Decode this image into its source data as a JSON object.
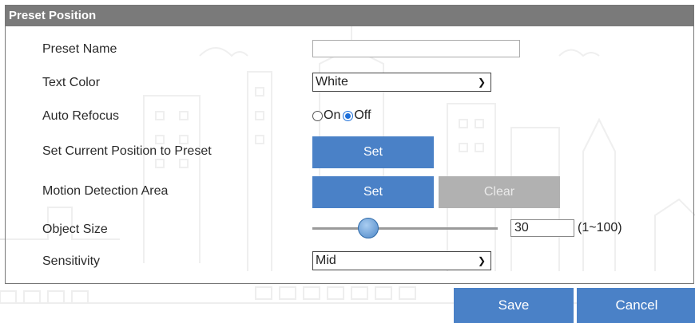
{
  "panel": {
    "title": "Preset Position"
  },
  "form": {
    "preset_name": {
      "label": "Preset Name",
      "value": "",
      "placeholder": ""
    },
    "text_color": {
      "label": "Text Color",
      "selected": "White"
    },
    "auto_refocus": {
      "label": "Auto Refocus",
      "on_label": "On",
      "off_label": "Off",
      "selected": "Off"
    },
    "set_current_position": {
      "label": "Set Current Position to Preset",
      "set_label": "Set"
    },
    "motion_detection": {
      "label": "Motion Detection Area",
      "set_label": "Set",
      "clear_label": "Clear"
    },
    "object_size": {
      "label": "Object Size",
      "value": "30",
      "range": "(1~100)",
      "level_fraction": 0.3
    },
    "sensitivity": {
      "label": "Sensitivity",
      "selected": "Mid"
    }
  },
  "footer": {
    "save_label": "Save",
    "cancel_label": "Cancel"
  },
  "colors": {
    "header_bg": "#7a7a7a",
    "accent_blue": "#4a81c7",
    "disabled_gray": "#b1b1b1"
  }
}
